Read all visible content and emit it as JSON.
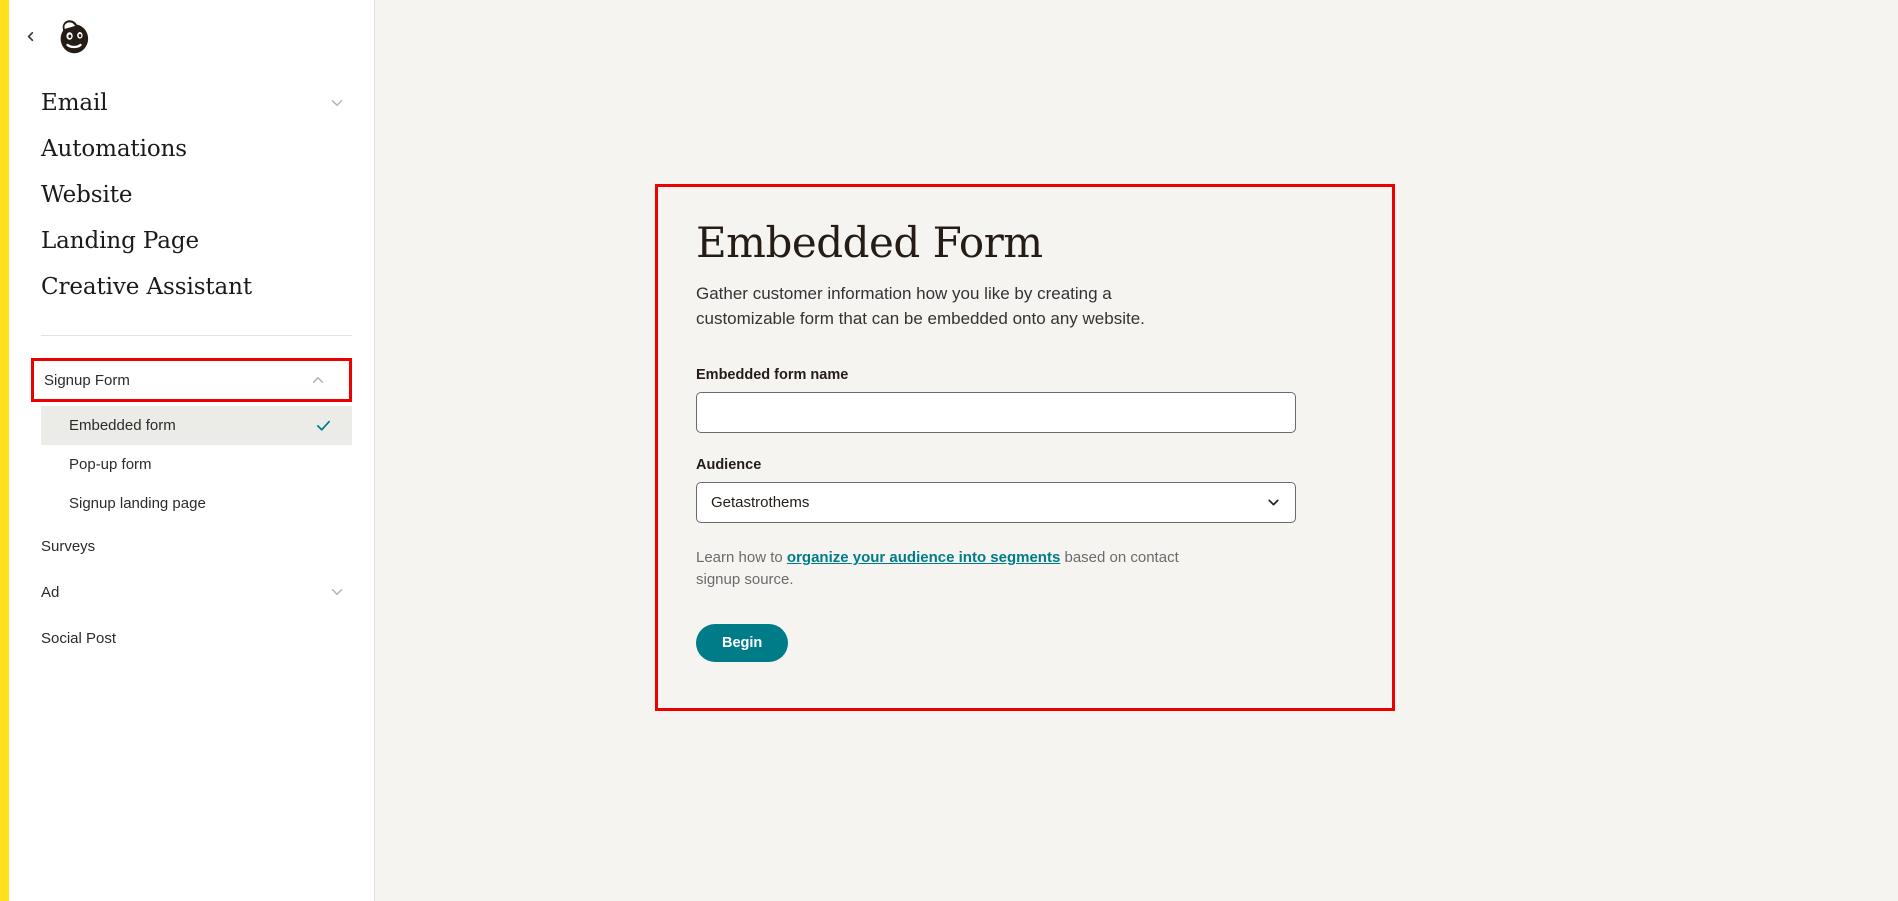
{
  "colors": {
    "accent_yellow": "#FFE01B",
    "teal": "#007C89",
    "annotation_red": "#ED0000",
    "canvas": "#F5F4F1",
    "selected_row": "#EBEBE8"
  },
  "sidebar": {
    "back_label": "Back",
    "logo_name": "Mailchimp Freddie logo",
    "primary_items": [
      {
        "label": "Email",
        "chevron": "chevron-down"
      },
      {
        "label": "Automations",
        "chevron": ""
      },
      {
        "label": "Website",
        "chevron": ""
      },
      {
        "label": "Landing Page",
        "chevron": ""
      },
      {
        "label": "Creative Assistant",
        "chevron": ""
      }
    ],
    "section": {
      "label": "Signup Form",
      "chevron": "chevron-up",
      "annotated": true
    },
    "sub_items": [
      {
        "label": "Embedded form",
        "selected": true,
        "check": "check-icon"
      },
      {
        "label": "Pop-up form",
        "selected": false,
        "check": ""
      },
      {
        "label": "Signup landing page",
        "selected": false,
        "check": ""
      }
    ],
    "secondary_items": [
      {
        "label": "Surveys",
        "chevron": ""
      },
      {
        "label": "Ad",
        "chevron": "chevron-down"
      },
      {
        "label": "Social Post",
        "chevron": ""
      }
    ]
  },
  "main": {
    "card": {
      "title": "Embedded Form",
      "description": "Gather customer information how you like by creating a customizable form that can be embedded onto any website.",
      "name_field": {
        "label": "Embedded form name",
        "value": "",
        "placeholder": ""
      },
      "audience_field": {
        "label": "Audience",
        "selected": "Getastrothems",
        "options": [
          "Getastrothems"
        ]
      },
      "help": {
        "prefix": "Learn how to ",
        "link": "organize your audience into segments",
        "suffix": " based on contact signup source."
      },
      "submit_label": "Begin"
    }
  }
}
